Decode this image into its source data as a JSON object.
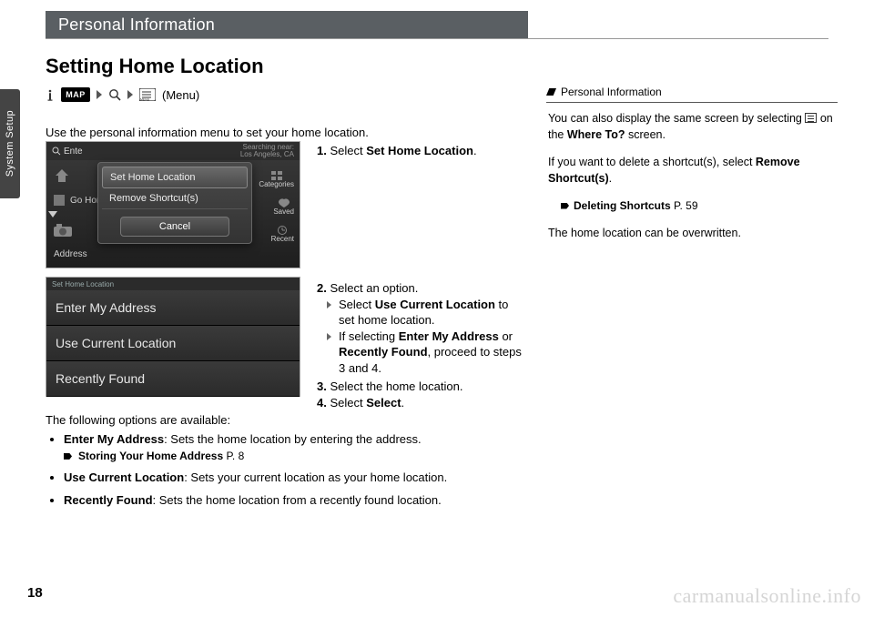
{
  "header": {
    "title": "Personal Information"
  },
  "subheader": "Setting Home Location",
  "side_tab": "System Setup",
  "breadcrumb": {
    "map_label": "MAP",
    "menu_label": "(Menu)"
  },
  "intro": "Use the personal information menu to set your home location.",
  "shot1": {
    "top_left": "Ente",
    "top_right": "Searching near:\nLos Angeles, CA",
    "modal": {
      "opt1": "Set Home Location",
      "opt2": "Remove Shortcut(s)",
      "cancel": "Cancel"
    },
    "underlay": {
      "go_home": "Go Hom",
      "address": "Address",
      "categories": "Categories",
      "saved": "Saved",
      "recent": "Recent"
    }
  },
  "shot2": {
    "hdr": "Set Home Location",
    "r1": "Enter My Address",
    "r2": "Use Current Location",
    "r3": "Recently Found"
  },
  "inst1": {
    "num": "1.",
    "text": "Select ",
    "bold": "Set Home Location",
    "tail": "."
  },
  "inst2": {
    "n2": "2.",
    "t2": "Select an option.",
    "sub2a_pre": "Select ",
    "sub2a_b": "Use Current Location",
    "sub2a_post": " to set home location.",
    "sub2b_pre": "If selecting ",
    "sub2b_b1": "Enter My Address",
    "sub2b_mid": " or ",
    "sub2b_b2": "Recently Found",
    "sub2b_post": ", proceed to steps 3 and 4.",
    "n3": "3.",
    "t3": "Select the home location.",
    "n4": "4.",
    "t4_pre": "Select ",
    "t4_b": "Select",
    "t4_post": "."
  },
  "opts_intro": "The following options are available:",
  "opts": {
    "o1_b": "Enter My Address",
    "o1_t": ": Sets the home location by entering the address.",
    "o1_xref_b": "Storing Your Home Address",
    "o1_xref_p": " P. 8",
    "o2_b": "Use Current Location",
    "o2_t": ": Sets your current location as your home location.",
    "o3_b": "Recently Found",
    "o3_t": ": Sets the home location from a recently found location."
  },
  "info": {
    "label": "Personal Information",
    "p1_pre": "You can also display the same screen by selecting ",
    "p1_post": " on the ",
    "p1_b": "Where To?",
    "p1_tail": " screen.",
    "p2_pre": "If you want to delete a shortcut(s), select ",
    "p2_b": "Remove Shortcut(s)",
    "p2_post": ".",
    "p2_xref_b": "Deleting Shortcuts",
    "p2_xref_p": " P. 59",
    "p3": "The home location can be overwritten."
  },
  "page_number": "18",
  "watermark": "carmanualsonline.info"
}
